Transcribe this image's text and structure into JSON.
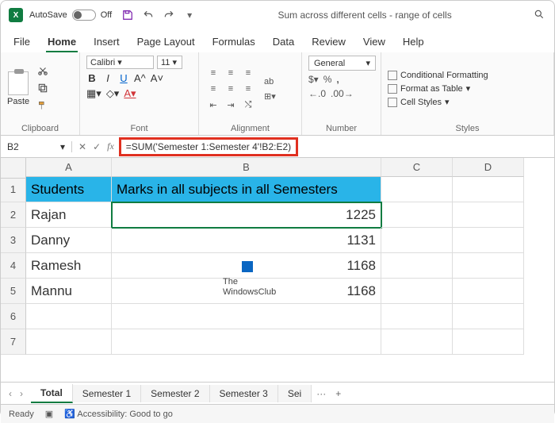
{
  "title": {
    "autosave": "AutoSave",
    "autosave_state": "Off",
    "doc": "Sum across different cells - range of cells"
  },
  "tabs": {
    "file": "File",
    "home": "Home",
    "insert": "Insert",
    "page": "Page Layout",
    "formulas": "Formulas",
    "data": "Data",
    "review": "Review",
    "view": "View",
    "help": "Help"
  },
  "ribbon": {
    "clipboard": {
      "label": "Clipboard",
      "paste": "Paste"
    },
    "font": {
      "label": "Font",
      "name": "Calibri",
      "size": "11",
      "bold": "B",
      "italic": "I",
      "aup": "A^",
      "adown": "A˅"
    },
    "align": {
      "label": "Alignment",
      "wrap": "ab"
    },
    "number": {
      "label": "Number",
      "format": "General",
      "pct": "%",
      "comma": ",",
      "dec_in": ".0",
      "dec_out": ".00"
    },
    "styles": {
      "label": "Styles",
      "cond": "Conditional Formatting",
      "table": "Format as Table",
      "cell": "Cell Styles"
    }
  },
  "fbar": {
    "name": "B2",
    "val": "=SUM('Semester 1:Semester 4'!B2:E2)"
  },
  "cols": {
    "A": "A",
    "B": "B",
    "C": "C",
    "D": "D"
  },
  "rows": [
    "1",
    "2",
    "3",
    "4",
    "5",
    "6",
    "7"
  ],
  "cells": {
    "A1": "Students",
    "B1": "Marks in all subjects in all Semesters",
    "A2": "Rajan",
    "B2": "1225",
    "A3": "Danny",
    "B3": "1131",
    "A4": "Ramesh",
    "B4": "1168",
    "A5": "Mannu",
    "B5": "1168"
  },
  "wmk": {
    "l1": "The",
    "l2": "WindowsClub"
  },
  "sheets": {
    "total": "Total",
    "s1": "Semester 1",
    "s2": "Semester 2",
    "s3": "Semester 3",
    "s4": "Sei",
    "dots": "···",
    "plus": "+"
  },
  "status": {
    "ready": "Ready",
    "acc": "Accessibility: Good to go"
  }
}
